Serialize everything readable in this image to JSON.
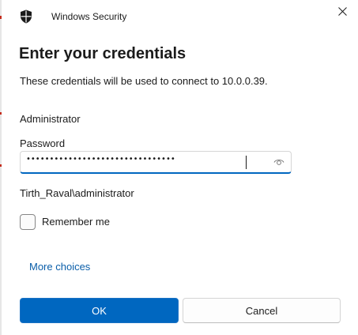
{
  "window": {
    "title": "Windows Security",
    "title_icon": "shield-icon",
    "close_icon": "close-icon"
  },
  "dialog": {
    "heading": "Enter your credentials",
    "description": "These credentials will be used to connect to 10.0.0.39.",
    "username": "Administrator",
    "password_label": "Password",
    "password_mask": "••••••••••••••••••••••••••••••••",
    "reveal_icon": "eye-icon",
    "account": "Tirth_Raval\\administrator",
    "remember_label": "Remember me",
    "remember_checked": false,
    "more_choices": "More choices"
  },
  "buttons": {
    "ok": "OK",
    "cancel": "Cancel"
  },
  "colors": {
    "accent": "#0067c0",
    "link": "#0a5ea9",
    "edge_mark": "#c42b1c"
  }
}
